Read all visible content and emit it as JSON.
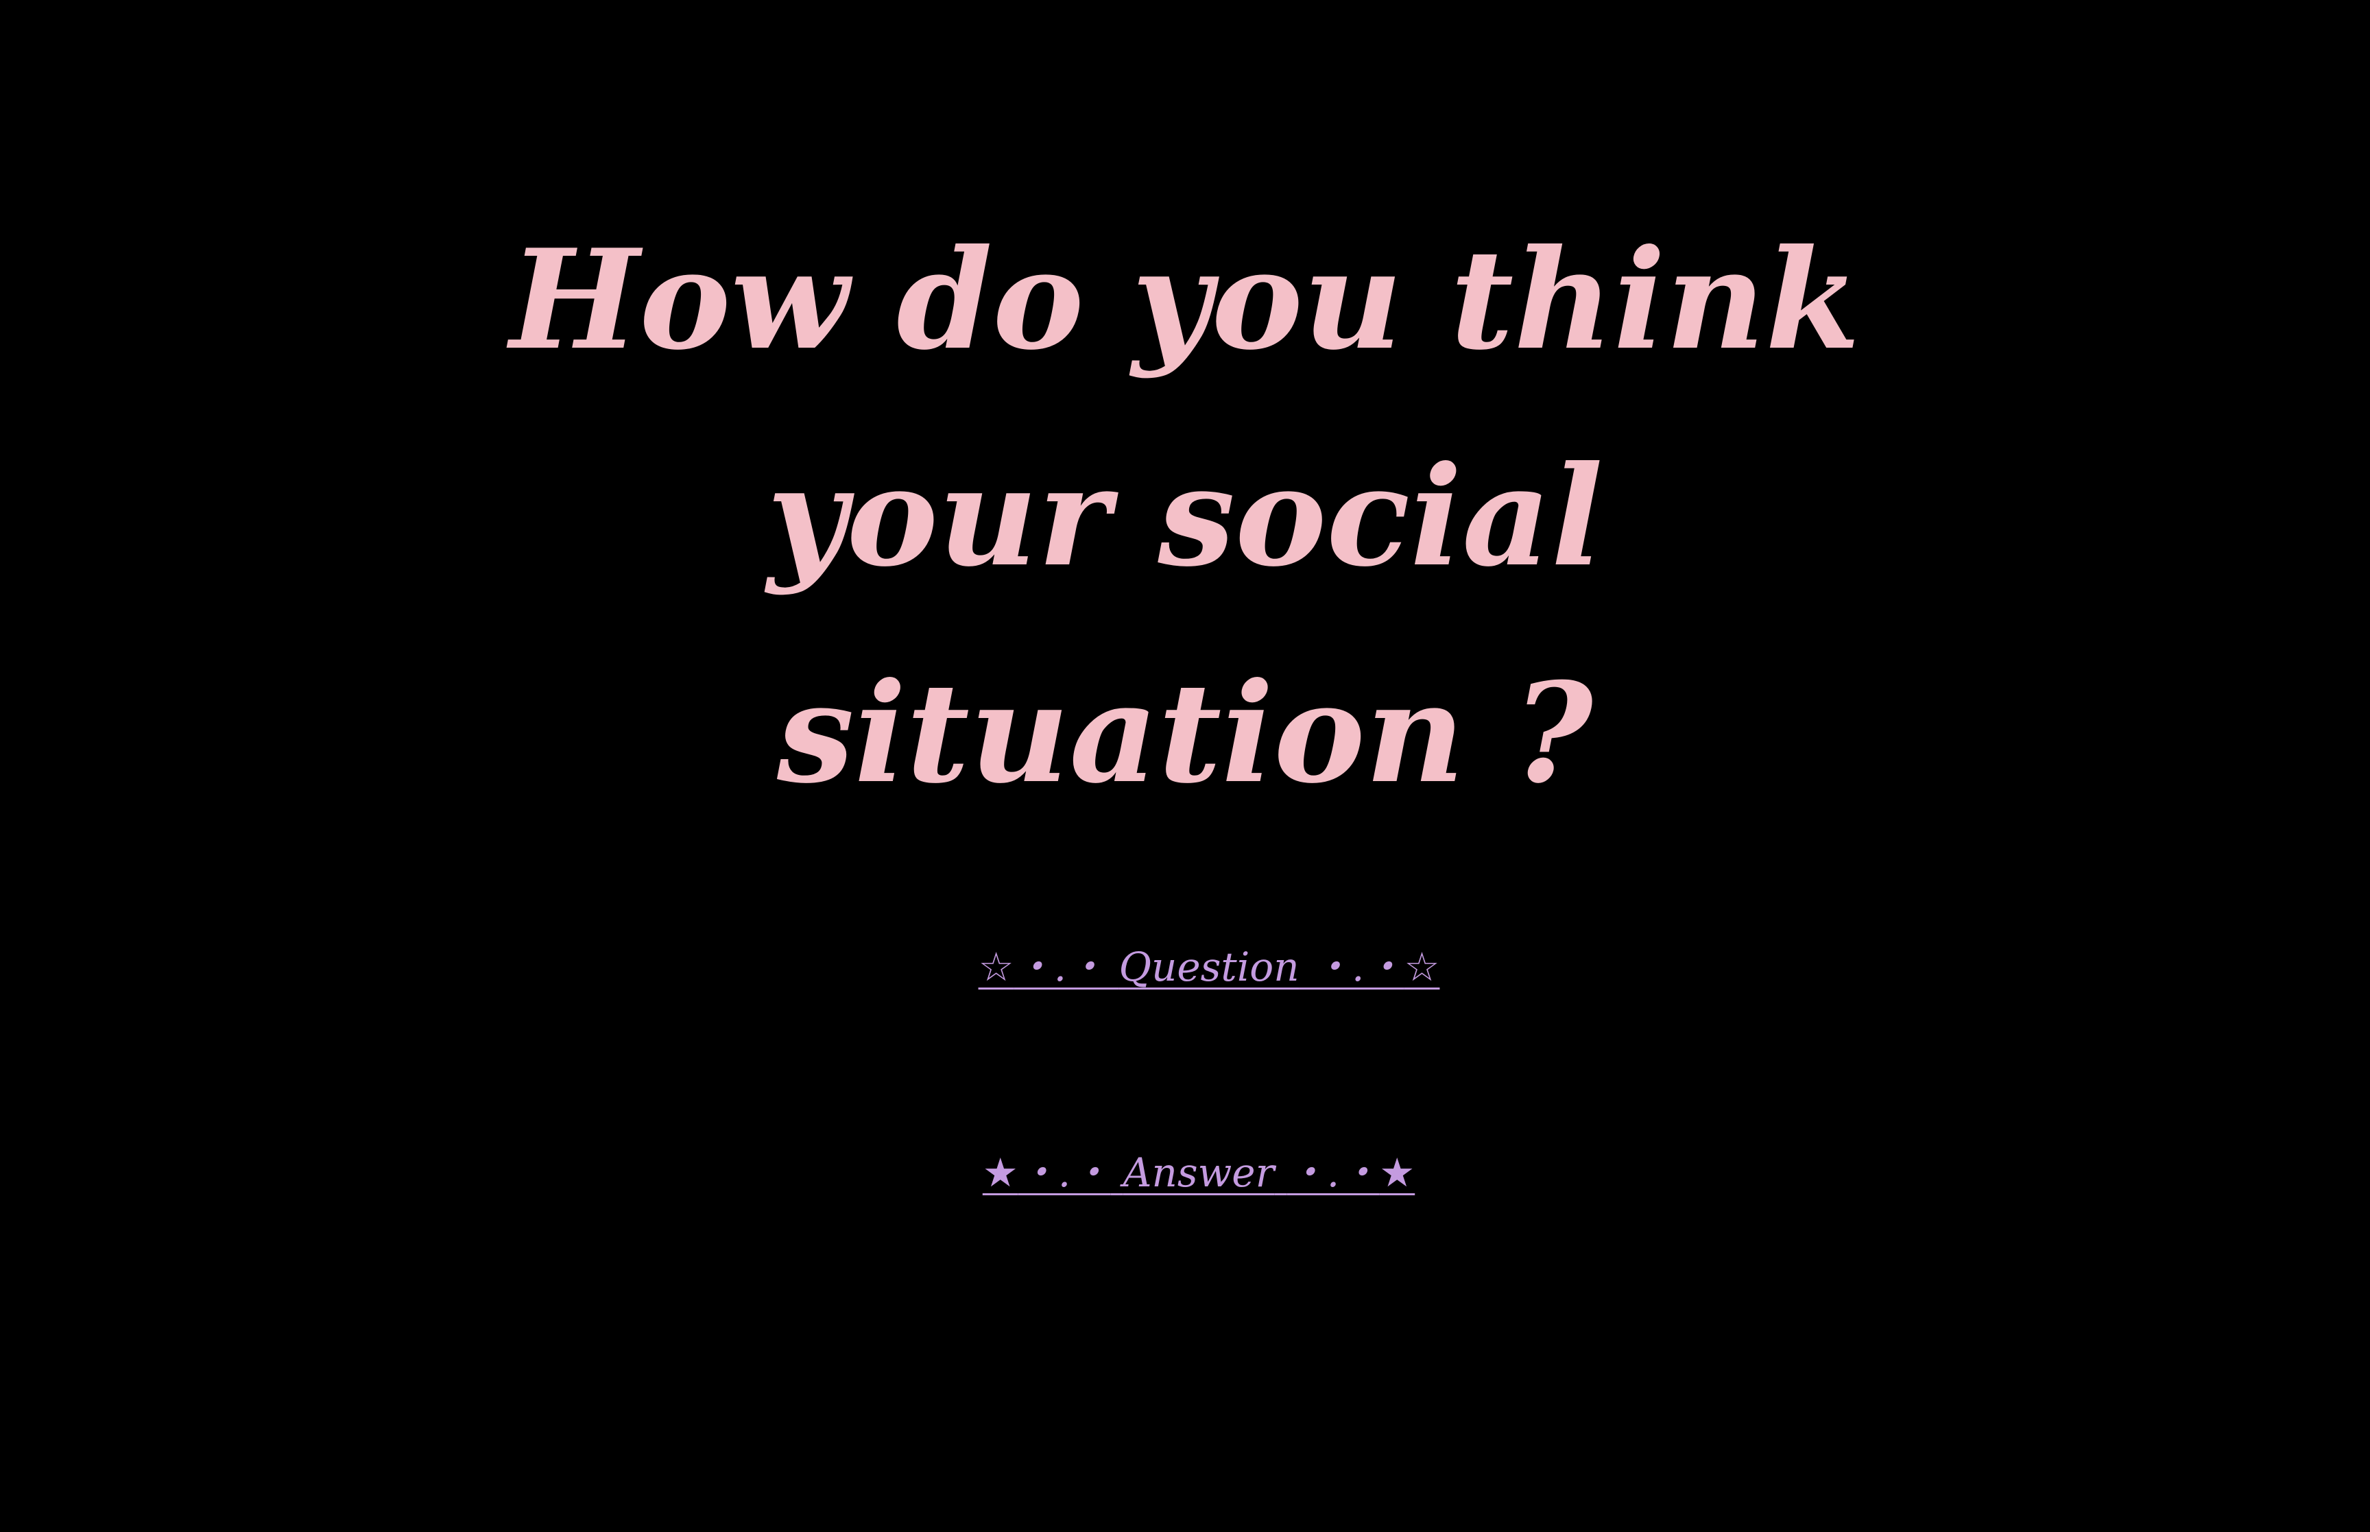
{
  "page": {
    "heading_lines": [
      "How do you think",
      "your social",
      "situation ?"
    ],
    "heading_color": "#f4c0c8",
    "link_color": "#c49be0",
    "background_color": "#000000"
  },
  "links": {
    "question": {
      "prefix_icon": "outline-star-icon",
      "prefix_glyph": "☆",
      "prefix_dots": "・.・",
      "label": "Question",
      "suffix_dots": "・.・",
      "suffix_glyph": "☆",
      "suffix_icon": "outline-star-icon"
    },
    "answer": {
      "prefix_icon": "filled-star-icon",
      "prefix_glyph": "★",
      "prefix_dots": "・.・",
      "label": "Answer",
      "suffix_dots": "・.・",
      "suffix_glyph": "★",
      "suffix_icon": "filled-star-icon"
    }
  }
}
